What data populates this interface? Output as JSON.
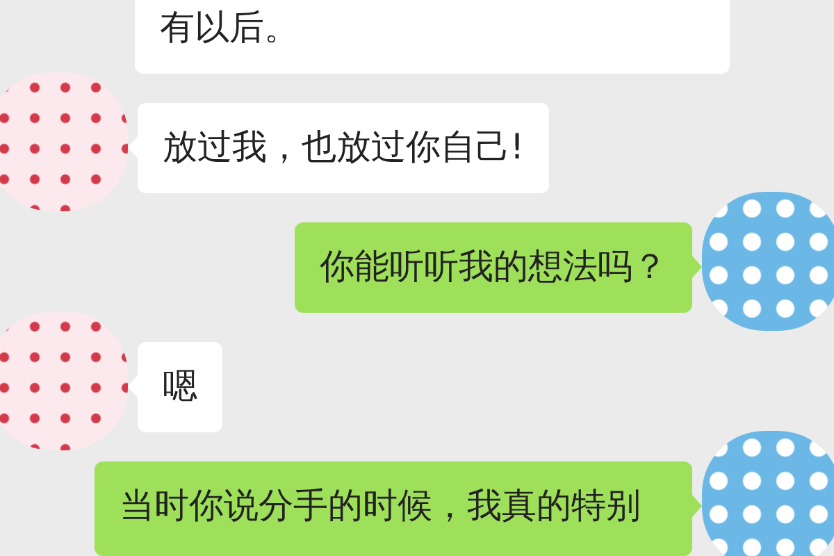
{
  "messages": [
    {
      "kind": "received",
      "avatar": false,
      "text": "有以后。"
    },
    {
      "kind": "received",
      "avatar": true,
      "text": "放过我，也放过你自己!"
    },
    {
      "kind": "sent",
      "avatar": true,
      "text": "你能听听我的想法吗？"
    },
    {
      "kind": "received",
      "avatar": true,
      "text": "嗯"
    },
    {
      "kind": "sent",
      "avatar": true,
      "text": "当时你说分手的时候，我真的特别"
    }
  ]
}
